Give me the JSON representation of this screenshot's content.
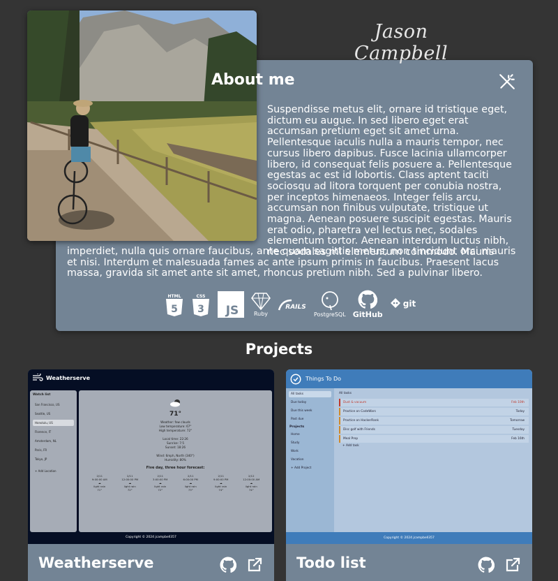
{
  "header": {
    "signature": "Jason Campbell"
  },
  "about": {
    "title": "About me",
    "bio_top": "Suspendisse metus elit, ornare id tristique eget, dictum eu augue. In sed libero eget erat accumsan pretium eget sit amet urna. Pellentesque iaculis nulla a mauris tempor, nec cursus libero dapibus. Fusce lacinia ullamcorper libero, id consequat felis posuere a. Pellentesque egestas ac est id lobortis. Class aptent taciti sociosqu ad litora torquent per conubia nostra, per inceptos himenaeos. Integer felis arcu, accumsan non finibus vulputate, tristique ut magna. Aenean posuere suscipit egestas. Mauris erat odio, pharetra vel lectus nec, sodales elementum tortor. Aenean interdum luctus nibh, nec sodales mi elementum commodo. Mauris",
    "bio_bottom": "imperdiet, nulla quis ornare faucibus, ante quam sagittis metus, non tincidunt orci mauris et nisi. Interdum et malesuada fames ac ante ipsum primis in faucibus. Praesent lacus massa, gravida sit amet ante sit amet, rhoncus pretium nibh. Sed a pulvinar libero.",
    "skills": {
      "html": "HTML",
      "css": "CSS",
      "js": "JS",
      "ruby": "Ruby",
      "rails": "RAILS",
      "postgres": "PostgreSQL",
      "github": "GitHub",
      "git": "git"
    }
  },
  "projects": {
    "title": "Projects",
    "weatherserve": {
      "name": "Weatherserve",
      "app_title": "Weatherserve",
      "watch_list_title": "Watch list",
      "cities": [
        "San Francisco, US",
        "Seattle, US",
        "Honolulu, US",
        "Florence, IT",
        "Amsterdam, NL",
        "Paris, FR",
        "Tokyo, JP"
      ],
      "add_location": "Add Location",
      "temp": "71°",
      "details": [
        "Weather: few clouds",
        "Low temperature: 67°",
        "High temperature: 72°",
        "",
        "Local time: 22:26",
        "Sunrise: 7:5",
        "Sunset: 18:26",
        "",
        "Wind: 6mph, North (340°)",
        "Humidity: 80%"
      ],
      "forecast_title": "Five day, three hour forecast:",
      "forecast": [
        {
          "date": "2/11",
          "time": "9:00:00 AM",
          "desc": "light rain",
          "temp": "71°"
        },
        {
          "date": "2/11",
          "time": "12:00:00 PM",
          "desc": "light rain",
          "temp": "72°"
        },
        {
          "date": "2/11",
          "time": "3:00:00 PM",
          "desc": "light rain",
          "temp": "72°"
        },
        {
          "date": "2/11",
          "time": "6:00:00 PM",
          "desc": "light rain",
          "temp": "73°"
        },
        {
          "date": "2/11",
          "time": "9:00:00 PM",
          "desc": "light rain",
          "temp": "74°"
        },
        {
          "date": "2/12",
          "time": "12:00:00 AM",
          "desc": "light rain",
          "temp": "74°"
        }
      ],
      "footer": "Copyright © 2024 jcampbell357"
    },
    "todo": {
      "name": "Todo list",
      "app_title": "Things To Do",
      "filters": [
        "All tasks",
        "Due today",
        "Due this week",
        "Past due"
      ],
      "projects_heading": "Projects",
      "project_items": [
        "Home",
        "Study",
        "Work",
        "Vacation"
      ],
      "add_project": "Add Project",
      "list_heading": "All tasks",
      "tasks": [
        {
          "title": "Dust & vacuum",
          "due": "Feb 10th"
        },
        {
          "title": "Practice on CodeWars",
          "due": "Today"
        },
        {
          "title": "Practice on HackerRank",
          "due": "Tomorrow"
        },
        {
          "title": "Disc golf with Friends",
          "due": "Tuesday"
        },
        {
          "title": "Meal Prep",
          "due": "Feb 16th"
        }
      ],
      "add_task": "Add task",
      "footer": "Copyright © 2024 jcampbell357"
    }
  },
  "colors": {
    "background": "#343434",
    "card": "#738495",
    "todo_accent": "#3f7cba",
    "weather_bg": "#050e24"
  }
}
